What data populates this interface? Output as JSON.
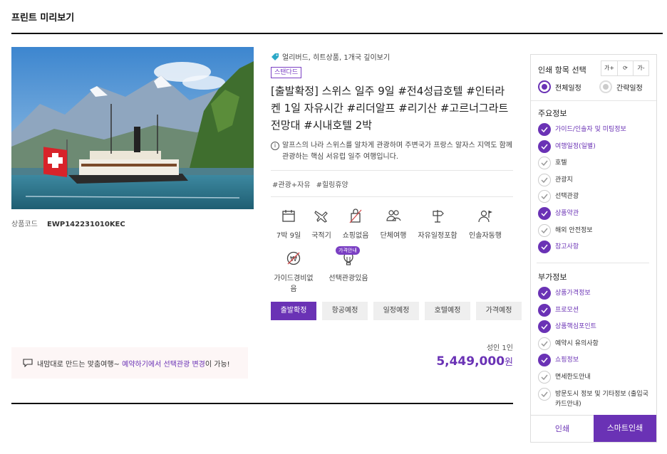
{
  "page": {
    "title": "프린트 미리보기"
  },
  "product": {
    "code_label": "상품코드",
    "code_value": "EWP142231010KEC",
    "tags_line": "얼리버드, 히트상품, 1개국 깊이보기",
    "badge": "스탠다드",
    "title": "[출발확정] 스위스 일주 9일 #전4성급호텔 #인터라켄 1일 자유시간 #리더알프 #리기산 #고르너그라트 전망대 #시내호텔 2박",
    "description": "알프스의 나라 스위스를 알차게 관광하며 주변국가 프랑스 알자스 지역도 함께 관광하는 핵심 서유럽 일주 여행입니다.",
    "hashtags": [
      "#관광+자유",
      "#힐링휴양"
    ],
    "features": [
      {
        "icon": "calendar-icon",
        "label": "7박 9일"
      },
      {
        "icon": "airplane-icon",
        "label": "국적기"
      },
      {
        "icon": "shopping-bag-crossed-icon",
        "label": "쇼핑없음"
      },
      {
        "icon": "group-icon",
        "label": "단체여행"
      },
      {
        "icon": "signpost-icon",
        "label": "자유일정포함"
      },
      {
        "icon": "guide-person-icon",
        "label": "인솔자동행"
      },
      {
        "icon": "won-crossed-icon",
        "label": "가이드경비없음"
      },
      {
        "icon": "balloon-icon",
        "label": "선택관광있음",
        "badge": "가격안내"
      }
    ],
    "status_buttons": [
      "출발확정",
      "항공예정",
      "일정예정",
      "호텔예정",
      "가격예정"
    ],
    "notice": {
      "prefix": "내맘대로 만드는 맞춤여행~ ",
      "highlight": "예약하기에서 선택관광 변경",
      "suffix": "이 가능!"
    },
    "price": {
      "label": "성인 1인",
      "amount": "5,449,000",
      "unit": "원"
    }
  },
  "panel": {
    "title": "인쇄 항목 선택",
    "tools": [
      "가+",
      "⟳",
      "가-"
    ],
    "radios": [
      {
        "label": "전체일정",
        "selected": true
      },
      {
        "label": "간략일정",
        "selected": false
      }
    ],
    "main_section": {
      "title": "주요정보",
      "items": [
        {
          "label": "가이드/인솔자 및 미팅정보",
          "checked": true
        },
        {
          "label": "여행일정(일별)",
          "checked": true
        },
        {
          "label": "호텔",
          "checked": false
        },
        {
          "label": "관광지",
          "checked": false
        },
        {
          "label": "선택관광",
          "checked": false
        },
        {
          "label": "상품약관",
          "checked": true
        },
        {
          "label": "해외 안전정보",
          "checked": false
        },
        {
          "label": "참고사항",
          "checked": true
        }
      ]
    },
    "extra_section": {
      "title": "부가정보",
      "items": [
        {
          "label": "상품가격정보",
          "checked": true
        },
        {
          "label": "프로모션",
          "checked": true
        },
        {
          "label": "상품핵심포인트",
          "checked": true
        },
        {
          "label": "예약시 유의사항",
          "checked": false
        },
        {
          "label": "쇼핑정보",
          "checked": true
        },
        {
          "label": "면세한도안내",
          "checked": false
        },
        {
          "label": "방문도시 정보 및 기타정보 (출입국카드안내)",
          "checked": false
        }
      ]
    },
    "print_label": "인쇄",
    "smart_print_label": "스마트인쇄"
  },
  "colors": {
    "accent": "#6a32b5",
    "notice_bg": "#fdf6f6"
  }
}
